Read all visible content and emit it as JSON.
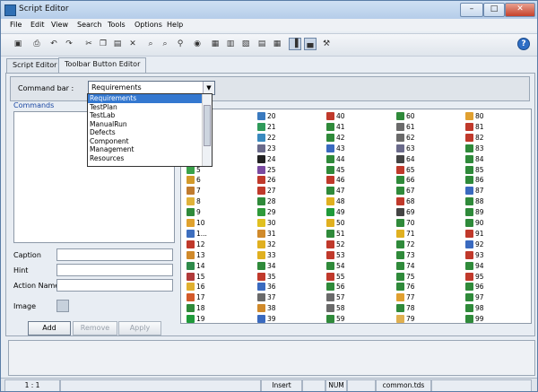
{
  "window": {
    "title": "Script Editor"
  },
  "window_controls": {
    "minimize": "–",
    "maximize": "□",
    "close": "✕"
  },
  "menu": [
    "File",
    "Edit",
    "View",
    "Search",
    "Tools",
    "Options",
    "Help"
  ],
  "toolbar_icons": [
    "save-icon",
    "print-icon",
    "undo-icon",
    "redo-icon",
    "cut-icon",
    "copy-icon",
    "paste-icon",
    "delete-icon",
    "find-icon",
    "find-next-icon",
    "replace-icon",
    "browser-icon",
    "properties-icon",
    "module-icon",
    "object-icon",
    "new-list-icon",
    "layout-icon",
    "toggle-pane-icon",
    "toggle-panel-icon",
    "tools-icon",
    "help-icon"
  ],
  "tabs": [
    "Script Editor",
    "Toolbar Button Editor"
  ],
  "command_bar": {
    "label": "Command bar :",
    "selected": "Requirements",
    "options": [
      "Requirements",
      "TestPlan",
      "TestLab",
      "ManualRun",
      "Defects",
      "Component",
      "Management",
      "Resources"
    ]
  },
  "commands_title": "Commands",
  "fields": {
    "caption": "Caption",
    "hint": "Hint",
    "action_name": "Action Name",
    "image": "Image"
  },
  "buttons": {
    "add": "Add",
    "remove": "Remove",
    "apply": "Apply"
  },
  "icon_grid": {
    "columns": [
      [
        {
          "n": "5",
          "c": "#3aa24a"
        },
        {
          "n": "6",
          "c": "#d39a2b"
        },
        {
          "n": "7",
          "c": "#c07b2e"
        },
        {
          "n": "8",
          "c": "#e0b23a"
        },
        {
          "n": "9",
          "c": "#2f8a3a"
        },
        {
          "n": "10",
          "c": "#e0a22e"
        },
        {
          "n": "1...",
          "c": "#3e6fbf"
        },
        {
          "n": "12",
          "c": "#c0392b"
        },
        {
          "n": "13",
          "c": "#d08a2b"
        },
        {
          "n": "14",
          "c": "#2e8a4a"
        },
        {
          "n": "15",
          "c": "#b03a3a"
        },
        {
          "n": "16",
          "c": "#e0b030"
        },
        {
          "n": "17",
          "c": "#d35a2a"
        },
        {
          "n": "18",
          "c": "#2f8a3a"
        },
        {
          "n": "19",
          "c": "#1f9a3a"
        }
      ],
      [
        {
          "n": "20",
          "c": "#3a7abf"
        },
        {
          "n": "21",
          "c": "#2f9a5a"
        },
        {
          "n": "22",
          "c": "#3a8abf"
        },
        {
          "n": "23",
          "c": "#6a6a8a"
        },
        {
          "n": "24",
          "c": "#222222"
        },
        {
          "n": "25",
          "c": "#7a4aa0"
        },
        {
          "n": "26",
          "c": "#c0392b"
        },
        {
          "n": "27",
          "c": "#c0392b"
        },
        {
          "n": "28",
          "c": "#2f8a3a"
        },
        {
          "n": "29",
          "c": "#2f9a3a"
        },
        {
          "n": "30",
          "c": "#e0c020"
        },
        {
          "n": "31",
          "c": "#d08a2b"
        },
        {
          "n": "32",
          "c": "#e0b020"
        },
        {
          "n": "33",
          "c": "#e0b020"
        },
        {
          "n": "34",
          "c": "#2f8a3a"
        },
        {
          "n": "35",
          "c": "#c0392b"
        },
        {
          "n": "36",
          "c": "#3a6abf"
        },
        {
          "n": "37",
          "c": "#6a6a6a"
        },
        {
          "n": "38",
          "c": "#d08a2b"
        },
        {
          "n": "39",
          "c": "#3a6abf"
        }
      ],
      [
        {
          "n": "40",
          "c": "#c0392b"
        },
        {
          "n": "41",
          "c": "#2f8a3a"
        },
        {
          "n": "42",
          "c": "#2f8a3a"
        },
        {
          "n": "43",
          "c": "#3a6abf"
        },
        {
          "n": "44",
          "c": "#2f8a3a"
        },
        {
          "n": "45",
          "c": "#2f8a3a"
        },
        {
          "n": "46",
          "c": "#c0392b"
        },
        {
          "n": "47",
          "c": "#2f8a3a"
        },
        {
          "n": "48",
          "c": "#e0b020"
        },
        {
          "n": "49",
          "c": "#1f9a3a"
        },
        {
          "n": "50",
          "c": "#e0b020"
        },
        {
          "n": "51",
          "c": "#2f8a3a"
        },
        {
          "n": "52",
          "c": "#c0392b"
        },
        {
          "n": "53",
          "c": "#c0392b"
        },
        {
          "n": "54",
          "c": "#2f8a3a"
        },
        {
          "n": "55",
          "c": "#c0392b"
        },
        {
          "n": "56",
          "c": "#2f8a3a"
        },
        {
          "n": "57",
          "c": "#6a6a6a"
        },
        {
          "n": "58",
          "c": "#6a6a6a"
        },
        {
          "n": "59",
          "c": "#2f8a3a"
        }
      ],
      [
        {
          "n": "60",
          "c": "#2f8a3a"
        },
        {
          "n": "61",
          "c": "#6a6a6a"
        },
        {
          "n": "62",
          "c": "#6a6a6a"
        },
        {
          "n": "63",
          "c": "#6a6a8a"
        },
        {
          "n": "64",
          "c": "#444444"
        },
        {
          "n": "65",
          "c": "#c0392b"
        },
        {
          "n": "66",
          "c": "#2f8a3a"
        },
        {
          "n": "67",
          "c": "#2f8a3a"
        },
        {
          "n": "68",
          "c": "#c0392b"
        },
        {
          "n": "69",
          "c": "#444444"
        },
        {
          "n": "70",
          "c": "#2f8a3a"
        },
        {
          "n": "71",
          "c": "#e0b020"
        },
        {
          "n": "72",
          "c": "#2f8a3a"
        },
        {
          "n": "73",
          "c": "#2f8a3a"
        },
        {
          "n": "74",
          "c": "#2f8a3a"
        },
        {
          "n": "75",
          "c": "#2f8a3a"
        },
        {
          "n": "76",
          "c": "#2f8a3a"
        },
        {
          "n": "77",
          "c": "#e0a030"
        },
        {
          "n": "78",
          "c": "#2f8a3a"
        },
        {
          "n": "79",
          "c": "#e0b050"
        }
      ],
      [
        {
          "n": "80",
          "c": "#e0a030"
        },
        {
          "n": "81",
          "c": "#c0392b"
        },
        {
          "n": "82",
          "c": "#c0392b"
        },
        {
          "n": "83",
          "c": "#2f8a3a"
        },
        {
          "n": "84",
          "c": "#2f8a3a"
        },
        {
          "n": "85",
          "c": "#2f8a3a"
        },
        {
          "n": "86",
          "c": "#2f8a3a"
        },
        {
          "n": "87",
          "c": "#3a6abf"
        },
        {
          "n": "88",
          "c": "#2f8a3a"
        },
        {
          "n": "89",
          "c": "#2f8a3a"
        },
        {
          "n": "90",
          "c": "#2f8a3a"
        },
        {
          "n": "91",
          "c": "#c0392b"
        },
        {
          "n": "92",
          "c": "#3a6abf"
        },
        {
          "n": "93",
          "c": "#c0392b"
        },
        {
          "n": "94",
          "c": "#2f8a3a"
        },
        {
          "n": "95",
          "c": "#c0392b"
        },
        {
          "n": "96",
          "c": "#2f8a3a"
        },
        {
          "n": "97",
          "c": "#2f8a3a"
        },
        {
          "n": "98",
          "c": "#2f8a3a"
        },
        {
          "n": "99",
          "c": "#2f8a3a"
        }
      ]
    ]
  },
  "status": {
    "position": "1 : 1",
    "mode": "Insert",
    "num": "NUM",
    "file": "common.tds"
  }
}
